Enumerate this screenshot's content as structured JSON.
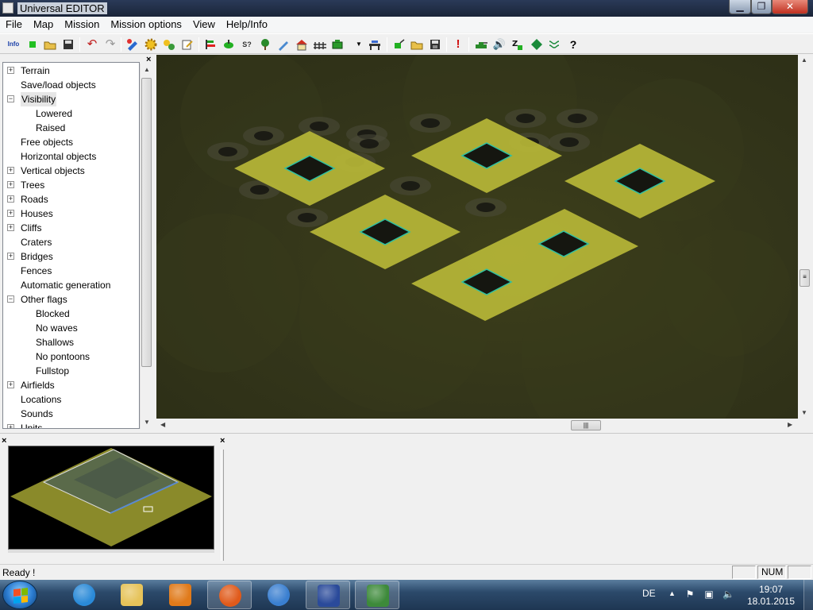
{
  "window": {
    "title": "Universal EDITOR"
  },
  "caption_buttons": {
    "minimize": "▁",
    "maximize": "❐",
    "close": "✕"
  },
  "menu": [
    "File",
    "Map",
    "Mission",
    "Mission options",
    "View",
    "Help/Info"
  ],
  "toolbar": {
    "info_label": "Info",
    "buttons": [
      "info-icon",
      "new-green-icon",
      "open-folder-icon",
      "save-icon",
      "undo-icon",
      "redo-icon",
      "paint-icon",
      "gear-yellow-icon",
      "gears-icon",
      "edit-icon",
      "flag-bar-icon",
      "green-dot-icon",
      "spawn-icon",
      "tree-icon",
      "pencil-icon",
      "house-icon",
      "fence-icon",
      "green-box-icon",
      "dropdown-arrow-icon",
      "bridge-icon",
      "green-export-icon",
      "folder-open-icon",
      "save-disk-icon",
      "alert-icon",
      "tank-icon",
      "sound-icon",
      "zz-icon",
      "diamond-green-icon",
      "wave-icon",
      "help-icon"
    ]
  },
  "tree": {
    "close_label": "×",
    "items": [
      {
        "label": "Terrain",
        "level": 0,
        "expander": "+"
      },
      {
        "label": "Save/load objects",
        "level": 0,
        "expander": ""
      },
      {
        "label": "Visibility",
        "level": 0,
        "expander": "−",
        "selected": true
      },
      {
        "label": "Lowered",
        "level": 1,
        "expander": ""
      },
      {
        "label": "Raised",
        "level": 1,
        "expander": ""
      },
      {
        "label": "Free objects",
        "level": 0,
        "expander": ""
      },
      {
        "label": "Horizontal objects",
        "level": 0,
        "expander": ""
      },
      {
        "label": "Vertical objects",
        "level": 0,
        "expander": "+"
      },
      {
        "label": "Trees",
        "level": 0,
        "expander": "+"
      },
      {
        "label": "Roads",
        "level": 0,
        "expander": "+"
      },
      {
        "label": "Houses",
        "level": 0,
        "expander": "+"
      },
      {
        "label": "Cliffs",
        "level": 0,
        "expander": "+"
      },
      {
        "label": "Craters",
        "level": 0,
        "expander": ""
      },
      {
        "label": "Bridges",
        "level": 0,
        "expander": "+"
      },
      {
        "label": "Fences",
        "level": 0,
        "expander": ""
      },
      {
        "label": "Automatic generation",
        "level": 0,
        "expander": ""
      },
      {
        "label": "Other flags",
        "level": 0,
        "expander": "−"
      },
      {
        "label": "Blocked",
        "level": 1,
        "expander": ""
      },
      {
        "label": "No waves",
        "level": 1,
        "expander": ""
      },
      {
        "label": "Shallows",
        "level": 1,
        "expander": ""
      },
      {
        "label": "No pontoons",
        "level": 1,
        "expander": ""
      },
      {
        "label": "Fullstop",
        "level": 1,
        "expander": ""
      },
      {
        "label": "Airfields",
        "level": 0,
        "expander": "+"
      },
      {
        "label": "Locations",
        "level": 0,
        "expander": ""
      },
      {
        "label": "Sounds",
        "level": 0,
        "expander": ""
      },
      {
        "label": "Units",
        "level": 0,
        "expander": "+"
      }
    ]
  },
  "scroll": {
    "up": "▲",
    "down": "▼",
    "left": "◀",
    "right": "▶",
    "grip_v": "≡",
    "grip_h": "|||"
  },
  "panels": {
    "minimap_close": "×",
    "info_close": "×"
  },
  "status": {
    "text": "Ready !",
    "pane_num": "NUM"
  },
  "taskbar": {
    "apps": [
      {
        "name": "internet-explorer-icon",
        "color": "#2a8ad8"
      },
      {
        "name": "file-explorer-icon",
        "color": "#e6c35a"
      },
      {
        "name": "media-player-icon",
        "color": "#e07a1a"
      },
      {
        "name": "firefox-icon",
        "color": "#e05a1a",
        "active": true
      },
      {
        "name": "blue-circle-app-icon",
        "color": "#3a7fd0"
      },
      {
        "name": "socket-app-icon",
        "color": "#2a4a9a",
        "active": true
      },
      {
        "name": "editor-app-icon",
        "color": "#3d8a3a",
        "active": true
      }
    ],
    "language": "DE",
    "tray_arrow": "▲",
    "time": "19:07",
    "date": "18.01.2015"
  },
  "colors": {
    "terrain_dark": "#33351a",
    "flag_yellow": "#b7b737",
    "pit_dark": "#151610",
    "pit_outline": "#2fc0a0",
    "minimap_bg": "#000000",
    "minimap_ground": "#8a8a2a"
  }
}
